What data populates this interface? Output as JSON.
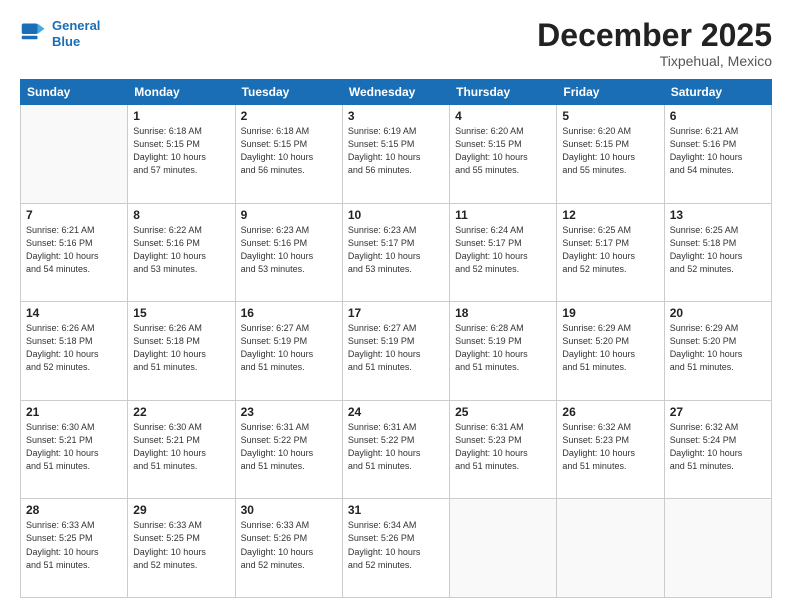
{
  "logo": {
    "line1": "General",
    "line2": "Blue"
  },
  "header": {
    "month": "December 2025",
    "location": "Tixpehual, Mexico"
  },
  "weekdays": [
    "Sunday",
    "Monday",
    "Tuesday",
    "Wednesday",
    "Thursday",
    "Friday",
    "Saturday"
  ],
  "weeks": [
    [
      {
        "day": "",
        "info": ""
      },
      {
        "day": "1",
        "info": "Sunrise: 6:18 AM\nSunset: 5:15 PM\nDaylight: 10 hours\nand 57 minutes."
      },
      {
        "day": "2",
        "info": "Sunrise: 6:18 AM\nSunset: 5:15 PM\nDaylight: 10 hours\nand 56 minutes."
      },
      {
        "day": "3",
        "info": "Sunrise: 6:19 AM\nSunset: 5:15 PM\nDaylight: 10 hours\nand 56 minutes."
      },
      {
        "day": "4",
        "info": "Sunrise: 6:20 AM\nSunset: 5:15 PM\nDaylight: 10 hours\nand 55 minutes."
      },
      {
        "day": "5",
        "info": "Sunrise: 6:20 AM\nSunset: 5:15 PM\nDaylight: 10 hours\nand 55 minutes."
      },
      {
        "day": "6",
        "info": "Sunrise: 6:21 AM\nSunset: 5:16 PM\nDaylight: 10 hours\nand 54 minutes."
      }
    ],
    [
      {
        "day": "7",
        "info": "Sunrise: 6:21 AM\nSunset: 5:16 PM\nDaylight: 10 hours\nand 54 minutes."
      },
      {
        "day": "8",
        "info": "Sunrise: 6:22 AM\nSunset: 5:16 PM\nDaylight: 10 hours\nand 53 minutes."
      },
      {
        "day": "9",
        "info": "Sunrise: 6:23 AM\nSunset: 5:16 PM\nDaylight: 10 hours\nand 53 minutes."
      },
      {
        "day": "10",
        "info": "Sunrise: 6:23 AM\nSunset: 5:17 PM\nDaylight: 10 hours\nand 53 minutes."
      },
      {
        "day": "11",
        "info": "Sunrise: 6:24 AM\nSunset: 5:17 PM\nDaylight: 10 hours\nand 52 minutes."
      },
      {
        "day": "12",
        "info": "Sunrise: 6:25 AM\nSunset: 5:17 PM\nDaylight: 10 hours\nand 52 minutes."
      },
      {
        "day": "13",
        "info": "Sunrise: 6:25 AM\nSunset: 5:18 PM\nDaylight: 10 hours\nand 52 minutes."
      }
    ],
    [
      {
        "day": "14",
        "info": "Sunrise: 6:26 AM\nSunset: 5:18 PM\nDaylight: 10 hours\nand 52 minutes."
      },
      {
        "day": "15",
        "info": "Sunrise: 6:26 AM\nSunset: 5:18 PM\nDaylight: 10 hours\nand 51 minutes."
      },
      {
        "day": "16",
        "info": "Sunrise: 6:27 AM\nSunset: 5:19 PM\nDaylight: 10 hours\nand 51 minutes."
      },
      {
        "day": "17",
        "info": "Sunrise: 6:27 AM\nSunset: 5:19 PM\nDaylight: 10 hours\nand 51 minutes."
      },
      {
        "day": "18",
        "info": "Sunrise: 6:28 AM\nSunset: 5:19 PM\nDaylight: 10 hours\nand 51 minutes."
      },
      {
        "day": "19",
        "info": "Sunrise: 6:29 AM\nSunset: 5:20 PM\nDaylight: 10 hours\nand 51 minutes."
      },
      {
        "day": "20",
        "info": "Sunrise: 6:29 AM\nSunset: 5:20 PM\nDaylight: 10 hours\nand 51 minutes."
      }
    ],
    [
      {
        "day": "21",
        "info": "Sunrise: 6:30 AM\nSunset: 5:21 PM\nDaylight: 10 hours\nand 51 minutes."
      },
      {
        "day": "22",
        "info": "Sunrise: 6:30 AM\nSunset: 5:21 PM\nDaylight: 10 hours\nand 51 minutes."
      },
      {
        "day": "23",
        "info": "Sunrise: 6:31 AM\nSunset: 5:22 PM\nDaylight: 10 hours\nand 51 minutes."
      },
      {
        "day": "24",
        "info": "Sunrise: 6:31 AM\nSunset: 5:22 PM\nDaylight: 10 hours\nand 51 minutes."
      },
      {
        "day": "25",
        "info": "Sunrise: 6:31 AM\nSunset: 5:23 PM\nDaylight: 10 hours\nand 51 minutes."
      },
      {
        "day": "26",
        "info": "Sunrise: 6:32 AM\nSunset: 5:23 PM\nDaylight: 10 hours\nand 51 minutes."
      },
      {
        "day": "27",
        "info": "Sunrise: 6:32 AM\nSunset: 5:24 PM\nDaylight: 10 hours\nand 51 minutes."
      }
    ],
    [
      {
        "day": "28",
        "info": "Sunrise: 6:33 AM\nSunset: 5:25 PM\nDaylight: 10 hours\nand 51 minutes."
      },
      {
        "day": "29",
        "info": "Sunrise: 6:33 AM\nSunset: 5:25 PM\nDaylight: 10 hours\nand 52 minutes."
      },
      {
        "day": "30",
        "info": "Sunrise: 6:33 AM\nSunset: 5:26 PM\nDaylight: 10 hours\nand 52 minutes."
      },
      {
        "day": "31",
        "info": "Sunrise: 6:34 AM\nSunset: 5:26 PM\nDaylight: 10 hours\nand 52 minutes."
      },
      {
        "day": "",
        "info": ""
      },
      {
        "day": "",
        "info": ""
      },
      {
        "day": "",
        "info": ""
      }
    ]
  ]
}
